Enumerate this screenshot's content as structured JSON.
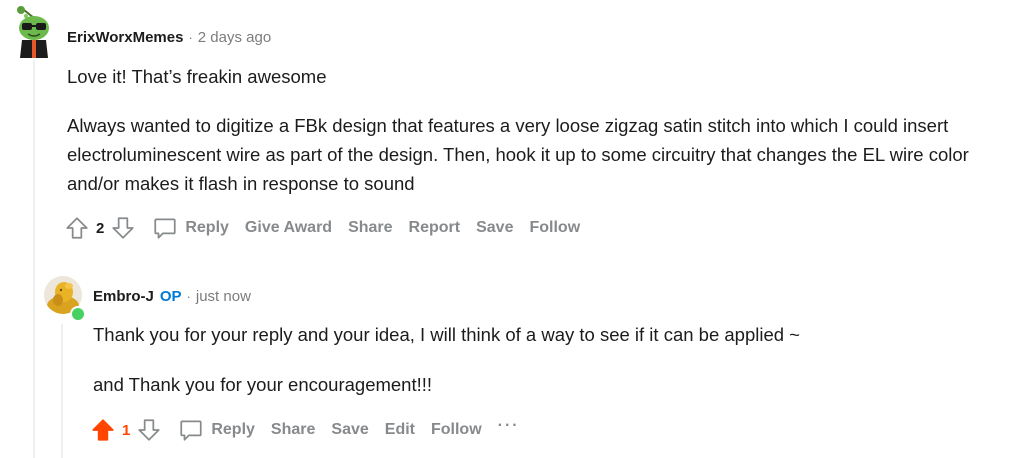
{
  "comments": [
    {
      "author": "ErixWorxMemes",
      "separator": "·",
      "time": "2 days ago",
      "paragraphs": [
        "Love it! That’s freakin awesome",
        "Always wanted to digitize a FBk design that features a very loose zigzag satin stitch into which I could insert electroluminescent wire as part of the design. Then, hook it up to some circuitry that changes the EL wire color and/or makes it flash in response to sound"
      ],
      "score": "2",
      "actions": {
        "reply": "Reply",
        "give_award": "Give Award",
        "share": "Share",
        "report": "Report",
        "save": "Save",
        "follow": "Follow"
      }
    },
    {
      "author": "Embro-J",
      "op_badge": "OP",
      "separator": "·",
      "time": "just now",
      "paragraphs": [
        "Thank you for your reply and your idea, I will think of a way to see if it can be applied ~",
        "and Thank you for your encouragement!!!"
      ],
      "score": "1",
      "upvoted": true,
      "actions": {
        "reply": "Reply",
        "share": "Share",
        "save": "Save",
        "edit": "Edit",
        "follow": "Follow",
        "more": "···"
      }
    }
  ],
  "colors": {
    "upvote_active": "#ff4500",
    "action_text": "#878a8c",
    "op_badge": "#0079d3",
    "online": "#46d160",
    "thread_line": "#edeff1"
  }
}
